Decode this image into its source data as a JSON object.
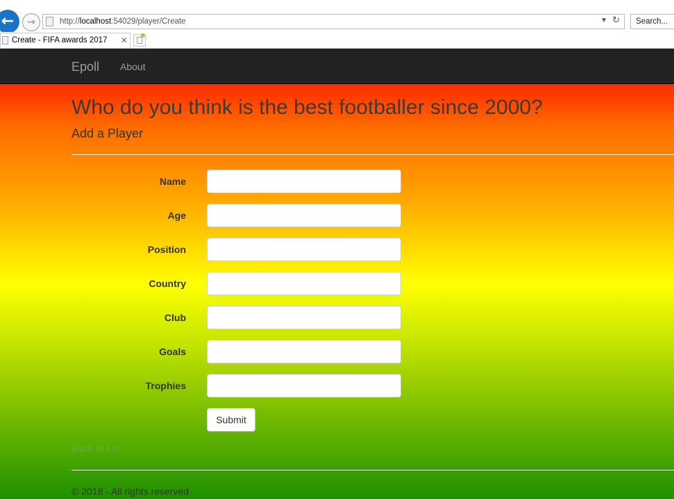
{
  "browser": {
    "url_prefix": "http://",
    "url_host": "localhost",
    "url_rest": ":54029/player/Create",
    "search_placeholder": "Search...",
    "tab_title": "Create - FIFA awards 2017"
  },
  "navbar": {
    "brand": "Epoll",
    "about": "About"
  },
  "page": {
    "heading": "Who do you think is the best footballer since 2000?",
    "subheading": "Add a Player"
  },
  "form": {
    "fields": [
      {
        "label": "Name",
        "value": ""
      },
      {
        "label": "Age",
        "value": ""
      },
      {
        "label": "Position",
        "value": ""
      },
      {
        "label": "Country",
        "value": ""
      },
      {
        "label": "Club",
        "value": ""
      },
      {
        "label": "Goals",
        "value": ""
      },
      {
        "label": "Trophies",
        "value": ""
      }
    ],
    "submit_label": "Submit"
  },
  "back_link": "Back to List",
  "footer": "© 2018 - All rights reserved",
  "colors": {
    "navbar_bg": "#222222",
    "gradient_top": "#ff2a00",
    "gradient_middle": "#ffff00",
    "gradient_bottom": "#1e9000",
    "back_button": "#1a73c6"
  }
}
